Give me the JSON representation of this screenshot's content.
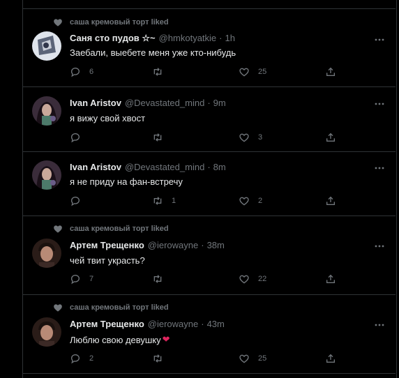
{
  "colors": {
    "bg": "#000000",
    "text": "#e7e9ea",
    "muted": "#71767b",
    "divider": "#2f3336",
    "heart": "#e0245e"
  },
  "tweets": [
    {
      "context": "саша кремовый торт liked",
      "name": "Саня сто пудов ☆~",
      "handle": "@hmkotyatkie",
      "time": "1h",
      "text": "Заебали, выебете меня уже кто-нибудь",
      "emoji": "",
      "replies": "6",
      "retweets": "",
      "likes": "25",
      "avatar": "anime"
    },
    {
      "context": "",
      "name": "Ivan Aristov",
      "handle": "@Devastated_mind",
      "time": "9m",
      "text": "я вижу свой хвост",
      "emoji": "",
      "replies": "",
      "retweets": "",
      "likes": "3",
      "avatar": "girl"
    },
    {
      "context": "",
      "name": "Ivan Aristov",
      "handle": "@Devastated_mind",
      "time": "8m",
      "text": "я не приду на фан-встречу",
      "emoji": "",
      "replies": "",
      "retweets": "1",
      "likes": "2",
      "avatar": "girl"
    },
    {
      "context": "саша кремовый торт liked",
      "name": "Артем Трещенко",
      "handle": "@ierowayne",
      "time": "38m",
      "text": "чей твит украсть?",
      "emoji": "",
      "replies": "7",
      "retweets": "",
      "likes": "22",
      "avatar": "man"
    },
    {
      "context": "саша кремовый торт liked",
      "name": "Артем Трещенко",
      "handle": "@ierowayne",
      "time": "43m",
      "text": "Люблю свою девушку",
      "emoji": "❤",
      "replies": "2",
      "retweets": "",
      "likes": "25",
      "avatar": "man"
    }
  ]
}
